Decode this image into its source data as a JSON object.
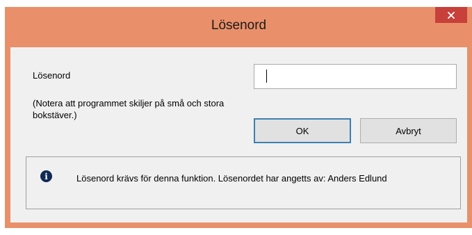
{
  "dialog": {
    "title": "Lösenord",
    "close_icon": "close-icon",
    "password_label": "Lösenord",
    "password_value": "",
    "note": "(Notera att programmet skiljer på små och stora bokstäver.)",
    "ok_label": "OK",
    "cancel_label": "Avbryt",
    "info_icon": "info-icon",
    "info_text": "Lösenord krävs för denna funktion. Lösenordet har angetts av: Anders Edlund"
  },
  "colors": {
    "frame": "#e9906a",
    "close_button": "#c7403a",
    "client": "#f0f0f0"
  }
}
